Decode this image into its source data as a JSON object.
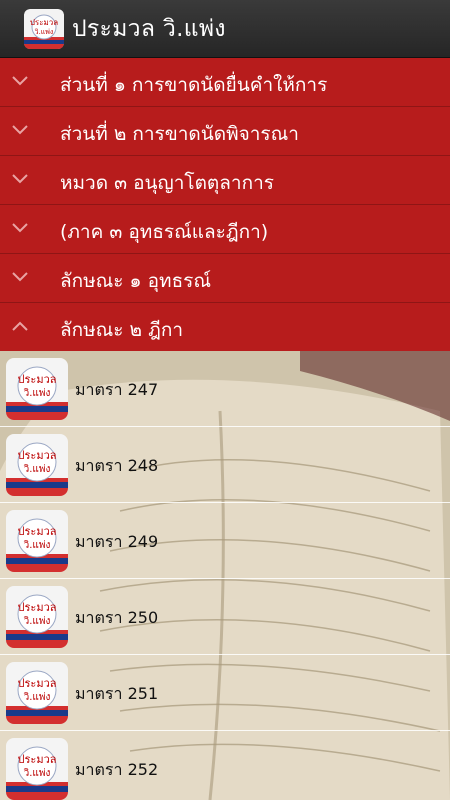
{
  "app_bar": {
    "title": "ประมวล วิ.แพ่ง",
    "icon_name": "app-logo-icon",
    "icon_text_line1": "ประมวล",
    "icon_text_line2": "วิ.แพ่ง"
  },
  "sections": [
    {
      "label": "ส่วนที่ ๑ การขาดนัดยื่นคำให้การ",
      "icon": "chevron-down-icon",
      "expanded": false
    },
    {
      "label": "ส่วนที่ ๒ การขาดนัดพิจารณา",
      "icon": "chevron-down-icon",
      "expanded": false
    },
    {
      "label": "หมวด ๓ อนุญาโตตุลาการ",
      "icon": "chevron-down-icon",
      "expanded": false
    },
    {
      "label": "(ภาค ๓ อุทธรณ์และฎีกา)",
      "icon": "chevron-down-icon",
      "expanded": false
    },
    {
      "label": "ลักษณะ ๑ อุทธรณ์",
      "icon": "chevron-down-icon",
      "expanded": false
    },
    {
      "label": "ลักษณะ ๒ ฎีกา",
      "icon": "chevron-up-icon",
      "expanded": true
    }
  ],
  "items": [
    {
      "label": "มาตรา 247"
    },
    {
      "label": "มาตรา 248"
    },
    {
      "label": "มาตรา 249"
    },
    {
      "label": "มาตรา 250"
    },
    {
      "label": "มาตรา 251"
    },
    {
      "label": "มาตรา 252"
    }
  ],
  "colors": {
    "app_bar": "#2e2e2e",
    "section_red": "#b71c1c",
    "text_white": "#ffffff",
    "logo_red": "#d32f2f",
    "logo_blue": "#1a3a8a"
  }
}
